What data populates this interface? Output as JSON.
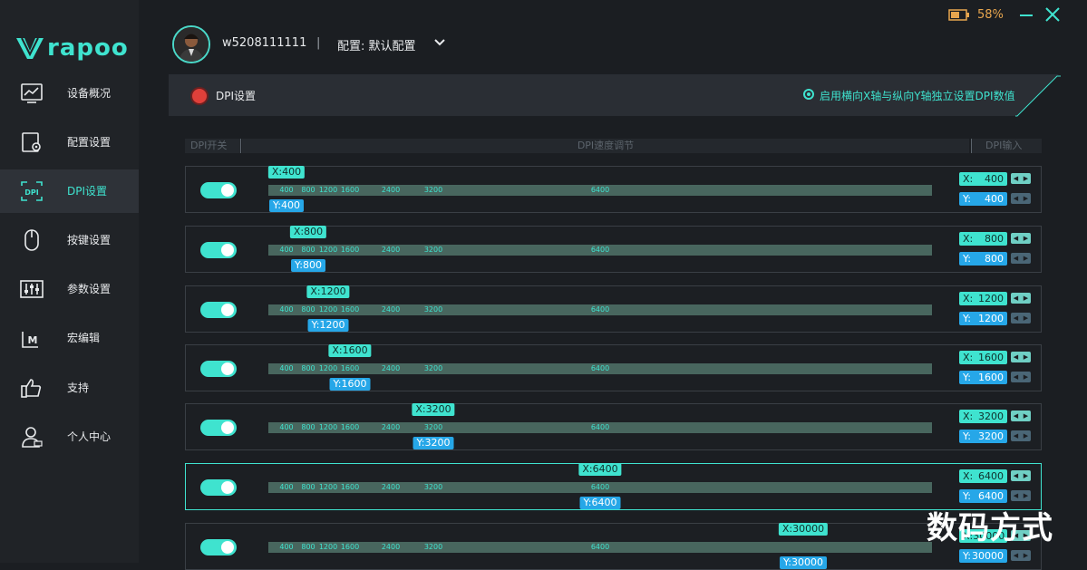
{
  "app": {
    "brand": "rapoo"
  },
  "header": {
    "username": "w5208111111",
    "separator": "|",
    "config_label": "配置: 默认配置",
    "battery_percent": "58%"
  },
  "sidebar": {
    "items": [
      {
        "label": "设备概况",
        "icon": "chart-monitor-icon"
      },
      {
        "label": "配置设置",
        "icon": "config-gear-icon"
      },
      {
        "label": "DPI设置",
        "icon": "dpi-icon",
        "active": true
      },
      {
        "label": "按键设置",
        "icon": "mouse-icon"
      },
      {
        "label": "参数设置",
        "icon": "sliders-icon"
      },
      {
        "label": "宏编辑",
        "icon": "macro-icon"
      },
      {
        "label": "支持",
        "icon": "thumbs-up-icon"
      },
      {
        "label": "个人中心",
        "icon": "user-icon"
      }
    ]
  },
  "panel": {
    "title": "DPI设置",
    "axis_option": "启用横向X轴与纵向Y轴独立设置DPI数值"
  },
  "columns": {
    "switch": "DPI开关",
    "slider": "DPI速度调节",
    "input": "DPI输入"
  },
  "ticks": [
    "400",
    "800",
    "1200",
    "1600",
    "2400",
    "3200",
    "6400"
  ],
  "rows": [
    {
      "enabled": true,
      "x_tag": "X:400",
      "y_tag": "Y:400",
      "x_value": 400,
      "y_value": 400,
      "x_label": "X:",
      "y_label": "Y:",
      "x_input": "400",
      "y_input": "400"
    },
    {
      "enabled": true,
      "x_tag": "X:800",
      "y_tag": "Y:800",
      "x_value": 800,
      "y_value": 800,
      "x_label": "X:",
      "y_label": "Y:",
      "x_input": "800",
      "y_input": "800"
    },
    {
      "enabled": true,
      "x_tag": "X:1200",
      "y_tag": "Y:1200",
      "x_value": 1200,
      "y_value": 1200,
      "x_label": "X:",
      "y_label": "Y:",
      "x_input": "1200",
      "y_input": "1200"
    },
    {
      "enabled": true,
      "x_tag": "X:1600",
      "y_tag": "Y:1600",
      "x_value": 1600,
      "y_value": 1600,
      "x_label": "X:",
      "y_label": "Y:",
      "x_input": "1600",
      "y_input": "1600"
    },
    {
      "enabled": true,
      "x_tag": "X:3200",
      "y_tag": "Y:3200",
      "x_value": 3200,
      "y_value": 3200,
      "x_label": "X:",
      "y_label": "Y:",
      "x_input": "3200",
      "y_input": "3200"
    },
    {
      "enabled": true,
      "selected": true,
      "x_tag": "X:6400",
      "y_tag": "Y:6400",
      "x_value": 6400,
      "y_value": 6400,
      "x_label": "X:",
      "y_label": "Y:",
      "x_input": "6400",
      "y_input": "6400"
    },
    {
      "enabled": true,
      "x_tag": "X:30000",
      "y_tag": "Y:30000",
      "x_value": 30000,
      "y_value": 30000,
      "x_label": "X:",
      "y_label": "Y:",
      "x_input": "30000",
      "y_input": "30000"
    }
  ],
  "colors": {
    "accent": "#3fe3cf",
    "y_accent": "#26a7e8",
    "battery": "#e8a64e",
    "record": "#e0403a"
  },
  "watermark": "数码方式"
}
